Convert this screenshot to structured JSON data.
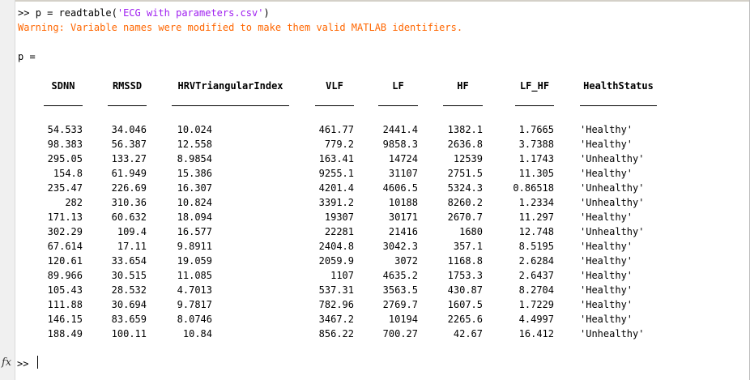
{
  "command": {
    "prompt": ">> ",
    "code_before": "p = readtable(",
    "string_arg": "'ECG with parameters.csv'",
    "code_after": ")"
  },
  "warning": "Warning: Variable names were modified to make them valid MATLAB identifiers.",
  "var_display": "p =",
  "table": {
    "headers": [
      "SDNN",
      "RMSSD",
      "HRVTriangularIndex",
      "VLF",
      "LF",
      "HF",
      "LF_HF",
      "HealthStatus"
    ],
    "rows": [
      [
        "54.533",
        "34.046",
        "10.024",
        "461.77",
        "2441.4",
        "1382.1",
        "1.7665",
        "'Healthy'"
      ],
      [
        "98.383",
        "56.387",
        "12.558",
        "779.2",
        "9858.3",
        "2636.8",
        "3.7388",
        "'Healthy'"
      ],
      [
        "295.05",
        "133.27",
        "8.9854",
        "163.41",
        "14724",
        "12539",
        "1.1743",
        "'Unhealthy'"
      ],
      [
        "154.8",
        "61.949",
        "15.386",
        "9255.1",
        "31107",
        "2751.5",
        "11.305",
        "'Healthy'"
      ],
      [
        "235.47",
        "226.69",
        "16.307",
        "4201.4",
        "4606.5",
        "5324.3",
        "0.86518",
        "'Unhealthy'"
      ],
      [
        "282",
        "310.36",
        "10.824",
        "3391.2",
        "10188",
        "8260.2",
        "1.2334",
        "'Unhealthy'"
      ],
      [
        "171.13",
        "60.632",
        "18.094",
        "19307",
        "30171",
        "2670.7",
        "11.297",
        "'Healthy'"
      ],
      [
        "302.29",
        "109.4",
        "16.577",
        "22281",
        "21416",
        "1680",
        "12.748",
        "'Unhealthy'"
      ],
      [
        "67.614",
        "17.11",
        "9.8911",
        "2404.8",
        "3042.3",
        "357.1",
        "8.5195",
        "'Healthy'"
      ],
      [
        "120.61",
        "33.654",
        "19.059",
        "2059.9",
        "3072",
        "1168.8",
        "2.6284",
        "'Healthy'"
      ],
      [
        "89.966",
        "30.515",
        "11.085",
        "1107",
        "4635.2",
        "1753.3",
        "2.6437",
        "'Healthy'"
      ],
      [
        "105.43",
        "28.532",
        "4.7013",
        "537.31",
        "3563.5",
        "430.87",
        "8.2704",
        "'Healthy'"
      ],
      [
        "111.88",
        "30.694",
        "9.7817",
        "782.96",
        "2769.7",
        "1607.5",
        "1.7229",
        "'Healthy'"
      ],
      [
        "146.15",
        "83.659",
        "8.0746",
        "3467.2",
        "10194",
        "2265.6",
        "4.4997",
        "'Healthy'"
      ],
      [
        "188.49",
        "100.11",
        "10.84",
        "856.22",
        "700.27",
        "42.67",
        "16.412",
        "'Unhealthy'"
      ]
    ]
  },
  "input": {
    "fx_icon": "fx",
    "prompt": ">> "
  },
  "colors": {
    "warning": "#ff6600",
    "string": "#a020f0",
    "gutter": "#f0f0f0"
  }
}
